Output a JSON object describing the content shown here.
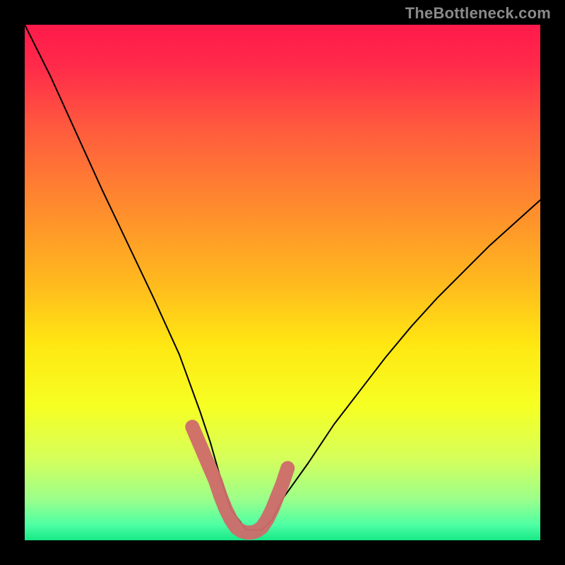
{
  "watermark": {
    "text": "TheBottleneck.com"
  },
  "chart_data": {
    "type": "line",
    "title": "",
    "xlabel": "",
    "ylabel": "",
    "xlim": [
      0,
      100
    ],
    "ylim": [
      0,
      100
    ],
    "grid": false,
    "curve": {
      "x": [
        0,
        5,
        10,
        15,
        20,
        25,
        30,
        34,
        36,
        38,
        40,
        43,
        46,
        48,
        50,
        55,
        60,
        65,
        70,
        75,
        80,
        85,
        90,
        95,
        100
      ],
      "y": [
        100,
        90,
        79,
        68,
        57.5,
        47,
        36,
        25,
        19,
        12,
        6,
        2,
        2,
        4,
        8,
        15,
        22.5,
        29,
        35.5,
        41.5,
        47,
        52,
        57,
        61.5,
        66
      ]
    },
    "highlight": {
      "color": "#cf6a6a",
      "x": [
        32.5,
        34,
        35.5,
        37,
        38,
        39,
        40,
        41,
        42,
        43,
        44,
        45,
        46,
        47,
        48,
        49,
        50,
        51
      ],
      "y": [
        22,
        18.5,
        15,
        11.5,
        8.5,
        6,
        4,
        2.5,
        1.8,
        1.5,
        1.5,
        1.8,
        2.5,
        4,
        6,
        8.5,
        11,
        14
      ]
    }
  }
}
